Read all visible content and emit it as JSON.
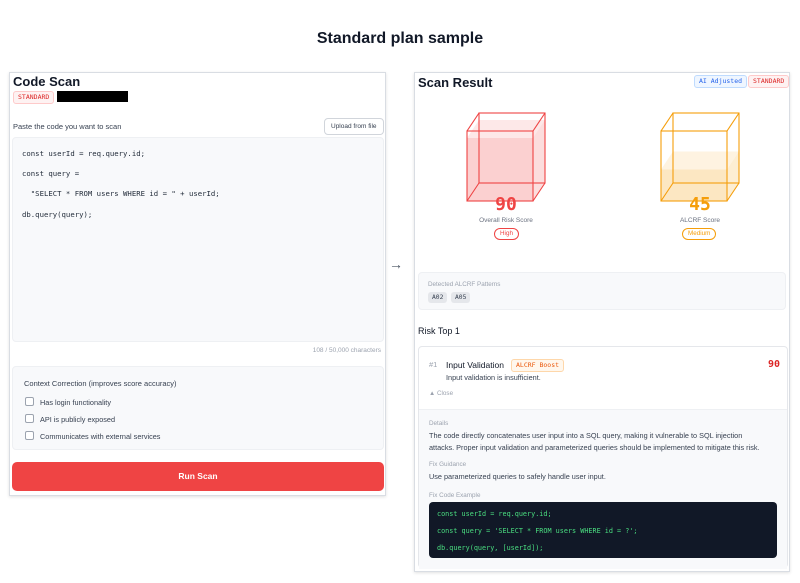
{
  "page": {
    "title": "Standard plan sample"
  },
  "scan": {
    "title": "Code Scan",
    "plan_badge": "STANDARD",
    "paste_label": "Paste the code you want to scan",
    "upload_label": "Upload from file",
    "code_lines": [
      "const userId = req.query.id;",
      "const query =",
      "  \"SELECT * FROM users WHERE id = \" + userId;",
      "db.query(query);"
    ],
    "char_count": "108 / 50,000 characters",
    "context": {
      "title": "Context Correction (improves score accuracy)",
      "options": [
        {
          "label": "Has login functionality",
          "checked": false
        },
        {
          "label": "API is publicly exposed",
          "checked": false
        },
        {
          "label": "Communicates with external services",
          "checked": false
        }
      ]
    },
    "run_label": "Run Scan"
  },
  "arrow": "→",
  "result": {
    "title": "Scan Result",
    "badges": [
      "AI Adjusted",
      "STANDARD"
    ],
    "gauges": [
      {
        "value": "90",
        "fill": 0.9,
        "label": "Overall Risk Score",
        "level": "High",
        "color": "#ef4444"
      },
      {
        "value": "45",
        "fill": 0.45,
        "label": "ALCRF Score",
        "level": "Medium",
        "color": "#f59e0b"
      }
    ],
    "patterns_title": "Detected ALCRF Patterns",
    "patterns": [
      "A02",
      "A05"
    ],
    "risk_top_title": "Risk Top 1",
    "risk": {
      "rank": "#1",
      "name": "Input Validation",
      "boost": "ALCRF Boost",
      "score": "90",
      "summary": "Input validation is insufficient.",
      "close_label": "▲ Close",
      "details_label": "Details",
      "details_lines": [
        "The code directly concatenates user input into a SQL query, making it vulnerable to SQL injection",
        "attacks. Proper input validation and parameterized queries should be implemented to mitigate this risk."
      ],
      "fix_label": "Fix Guidance",
      "fix_text": "Use parameterized queries to safely handle user input.",
      "example_label": "Fix Code Example",
      "example_lines": [
        "const userId = req.query.id;",
        "const query = 'SELECT * FROM users WHERE id = ?';",
        "db.query(query, [userId]);"
      ]
    }
  }
}
